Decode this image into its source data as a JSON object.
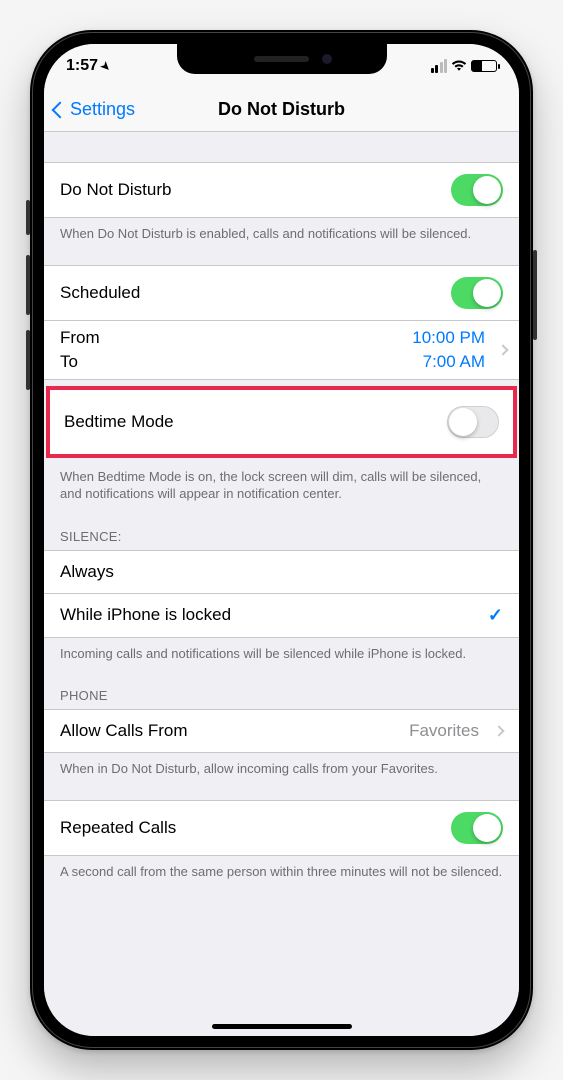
{
  "status": {
    "time": "1:57",
    "location_icon": "◤"
  },
  "nav": {
    "back_label": "Settings",
    "title": "Do Not Disturb"
  },
  "dnd": {
    "label": "Do Not Disturb",
    "enabled": true,
    "footer": "When Do Not Disturb is enabled, calls and notifications will be silenced."
  },
  "scheduled": {
    "label": "Scheduled",
    "enabled": true,
    "from_label": "From",
    "from_value": "10:00 PM",
    "to_label": "To",
    "to_value": "7:00 AM"
  },
  "bedtime": {
    "label": "Bedtime Mode",
    "enabled": false,
    "footer": "When Bedtime Mode is on, the lock screen will dim, calls will be silenced, and notifications will appear in notification center."
  },
  "silence": {
    "header": "SILENCE:",
    "always_label": "Always",
    "locked_label": "While iPhone is locked",
    "selected": "locked",
    "footer": "Incoming calls and notifications will be silenced while iPhone is locked."
  },
  "phone": {
    "header": "PHONE",
    "allow_label": "Allow Calls From",
    "allow_value": "Favorites",
    "allow_footer": "When in Do Not Disturb, allow incoming calls from your Favorites.",
    "repeated_label": "Repeated Calls",
    "repeated_enabled": true,
    "repeated_footer": "A second call from the same person within three minutes will not be silenced."
  }
}
